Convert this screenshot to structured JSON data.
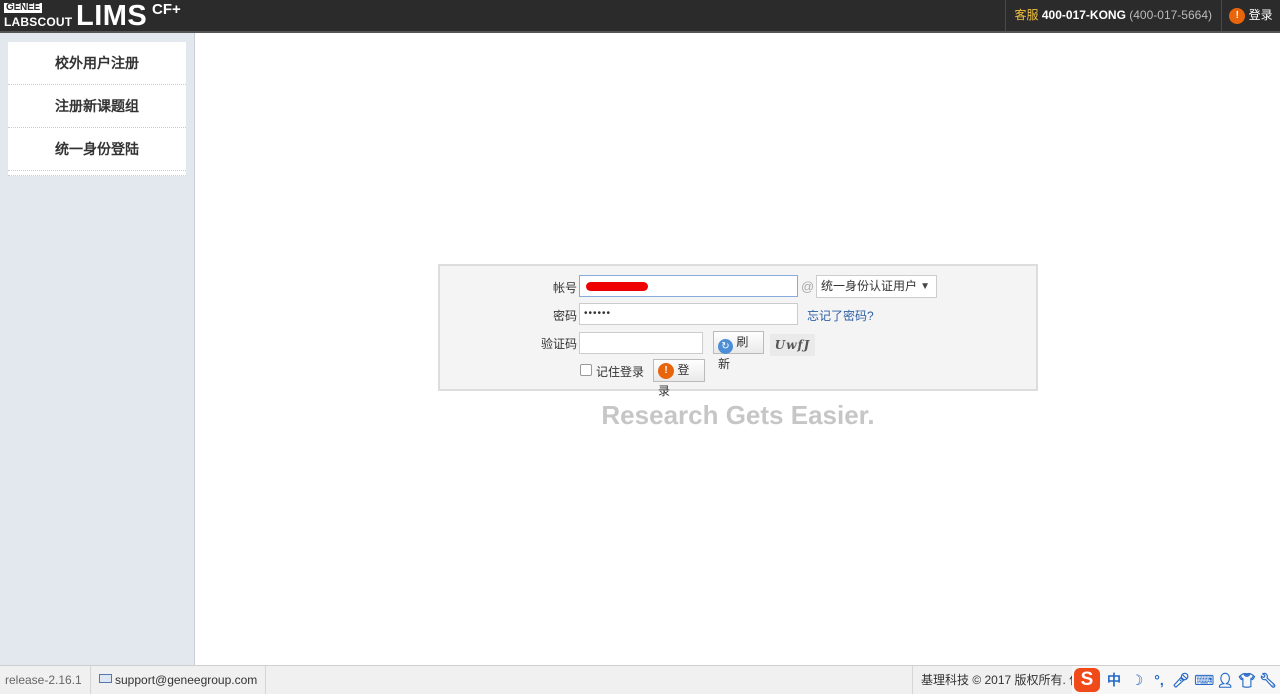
{
  "header": {
    "logo": {
      "brand_small": "GENEE",
      "brand_sub": "LABSCOUT",
      "product": "LIMS",
      "edition": "CF+"
    },
    "hotline": {
      "label": "客服",
      "number": "400-017-KONG",
      "alt_number": "(400-017-5664)"
    },
    "login_label": "登录"
  },
  "sidebar": {
    "items": [
      {
        "label": "校外用户注册"
      },
      {
        "label": "注册新课题组"
      },
      {
        "label": "统一身份登陆"
      }
    ]
  },
  "login_form": {
    "account_label": "帐号",
    "account_value": "",
    "at_symbol": "@",
    "domain_selected": "统一身份认证用户",
    "password_label": "密码",
    "password_value": "••••••",
    "forgot_password": "忘记了密码?",
    "captcha_label": "验证码",
    "captcha_value": "",
    "refresh_label": "刷新",
    "captcha_text": "UwfJ",
    "remember_label": "记住登录",
    "submit_label": "登录"
  },
  "slogan": "Research Gets Easier.",
  "footer": {
    "release": "release-2.16.1",
    "support_email": "support@geneegroup.com",
    "copyright": "基理科技 © 2017 版权所有. 保"
  },
  "ime_toolbar": {
    "logo": "S",
    "mode": "中",
    "icons": [
      "moon-icon",
      "punctuation-icon",
      "microphone-icon",
      "keyboard-icon",
      "user-icon",
      "shirt-icon",
      "wrench-icon"
    ]
  },
  "colors": {
    "header_bg": "#2b2b2b",
    "sidebar_bg": "#e3e8ee",
    "accent_orange": "#e8650b",
    "link_blue": "#2c5ea6",
    "slogan_gray": "#c6c6c6"
  }
}
